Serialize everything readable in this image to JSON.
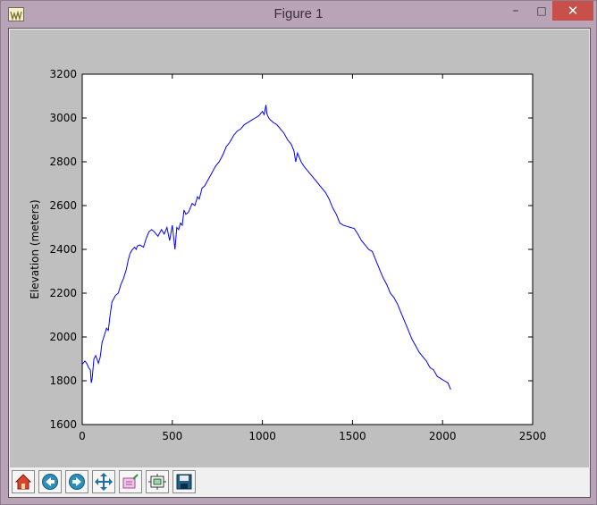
{
  "window": {
    "title": "Figure 1",
    "minimize_glyph": "–",
    "maximize_glyph": "□",
    "close_glyph": "✕"
  },
  "toolbar": {
    "tools": [
      {
        "name": "home-button",
        "icon": "home-icon"
      },
      {
        "name": "back-button",
        "icon": "arrow-left-icon"
      },
      {
        "name": "forward-button",
        "icon": "arrow-right-icon"
      },
      {
        "name": "pan-button",
        "icon": "pan-move-icon"
      },
      {
        "name": "zoom-button",
        "icon": "zoom-rectangle-icon"
      },
      {
        "name": "configure-subplots-button",
        "icon": "subplots-icon"
      },
      {
        "name": "save-button",
        "icon": "save-disk-icon"
      }
    ]
  },
  "colors": {
    "line": "#0000ff",
    "figure_background": "#bfbfbf",
    "axes_background": "#ffffff",
    "close_button": "#c7504b"
  },
  "chart_data": {
    "type": "line",
    "title": "",
    "xlabel": "",
    "ylabel": "Elevation (meters)",
    "xlim": [
      0,
      2500
    ],
    "ylim": [
      1600,
      3200
    ],
    "xticks": [
      0,
      500,
      1000,
      1500,
      2000,
      2500
    ],
    "yticks": [
      1600,
      1800,
      2000,
      2200,
      2400,
      2600,
      2800,
      3000,
      3200
    ],
    "grid": false,
    "legend": "none",
    "series": [
      {
        "x": [
          0,
          15,
          25,
          35,
          45,
          50,
          55,
          65,
          75,
          90,
          100,
          110,
          120,
          135,
          145,
          155,
          165,
          175,
          185,
          200,
          215,
          230,
          245,
          255,
          265,
          275,
          290,
          300,
          305,
          320,
          340,
          355,
          370,
          385,
          400,
          420,
          440,
          455,
          470,
          485,
          500,
          515,
          525,
          535,
          545,
          555,
          565,
          575,
          590,
          600,
          610,
          625,
          640,
          650,
          665,
          680,
          700,
          720,
          740,
          760,
          780,
          800,
          820,
          840,
          860,
          880,
          900,
          920,
          940,
          960,
          980,
          1000,
          1010,
          1020,
          1025,
          1030,
          1035,
          1045,
          1060,
          1080,
          1100,
          1120,
          1140,
          1160,
          1175,
          1185,
          1195,
          1205,
          1215,
          1230,
          1250,
          1270,
          1290,
          1310,
          1330,
          1350,
          1370,
          1390,
          1410,
          1430,
          1450,
          1470,
          1490,
          1510,
          1530,
          1550,
          1570,
          1590,
          1610,
          1630,
          1650,
          1670,
          1690,
          1710,
          1730,
          1750,
          1770,
          1790,
          1810,
          1830,
          1850,
          1870,
          1890,
          1910,
          1930,
          1950,
          1970,
          1990,
          2010,
          2030,
          2045
        ],
        "y": [
          1875,
          1890,
          1880,
          1860,
          1850,
          1790,
          1810,
          1900,
          1915,
          1880,
          1910,
          1975,
          2000,
          2040,
          2030,
          2100,
          2160,
          2175,
          2190,
          2200,
          2240,
          2270,
          2310,
          2350,
          2380,
          2395,
          2410,
          2400,
          2415,
          2420,
          2410,
          2450,
          2480,
          2490,
          2480,
          2460,
          2490,
          2470,
          2500,
          2440,
          2510,
          2400,
          2500,
          2490,
          2520,
          2510,
          2580,
          2560,
          2570,
          2590,
          2610,
          2600,
          2640,
          2630,
          2680,
          2690,
          2720,
          2750,
          2780,
          2800,
          2830,
          2870,
          2890,
          2920,
          2940,
          2950,
          2970,
          2980,
          2990,
          3000,
          3010,
          3030,
          3015,
          3060,
          3020,
          3010,
          3000,
          2990,
          2980,
          2970,
          2950,
          2930,
          2900,
          2880,
          2850,
          2800,
          2840,
          2820,
          2800,
          2780,
          2760,
          2740,
          2720,
          2700,
          2680,
          2660,
          2630,
          2590,
          2560,
          2520,
          2510,
          2505,
          2500,
          2495,
          2470,
          2440,
          2420,
          2400,
          2390,
          2350,
          2310,
          2270,
          2240,
          2200,
          2180,
          2150,
          2110,
          2070,
          2030,
          1990,
          1960,
          1930,
          1910,
          1890,
          1860,
          1850,
          1820,
          1810,
          1800,
          1790,
          1760
        ]
      }
    ]
  }
}
